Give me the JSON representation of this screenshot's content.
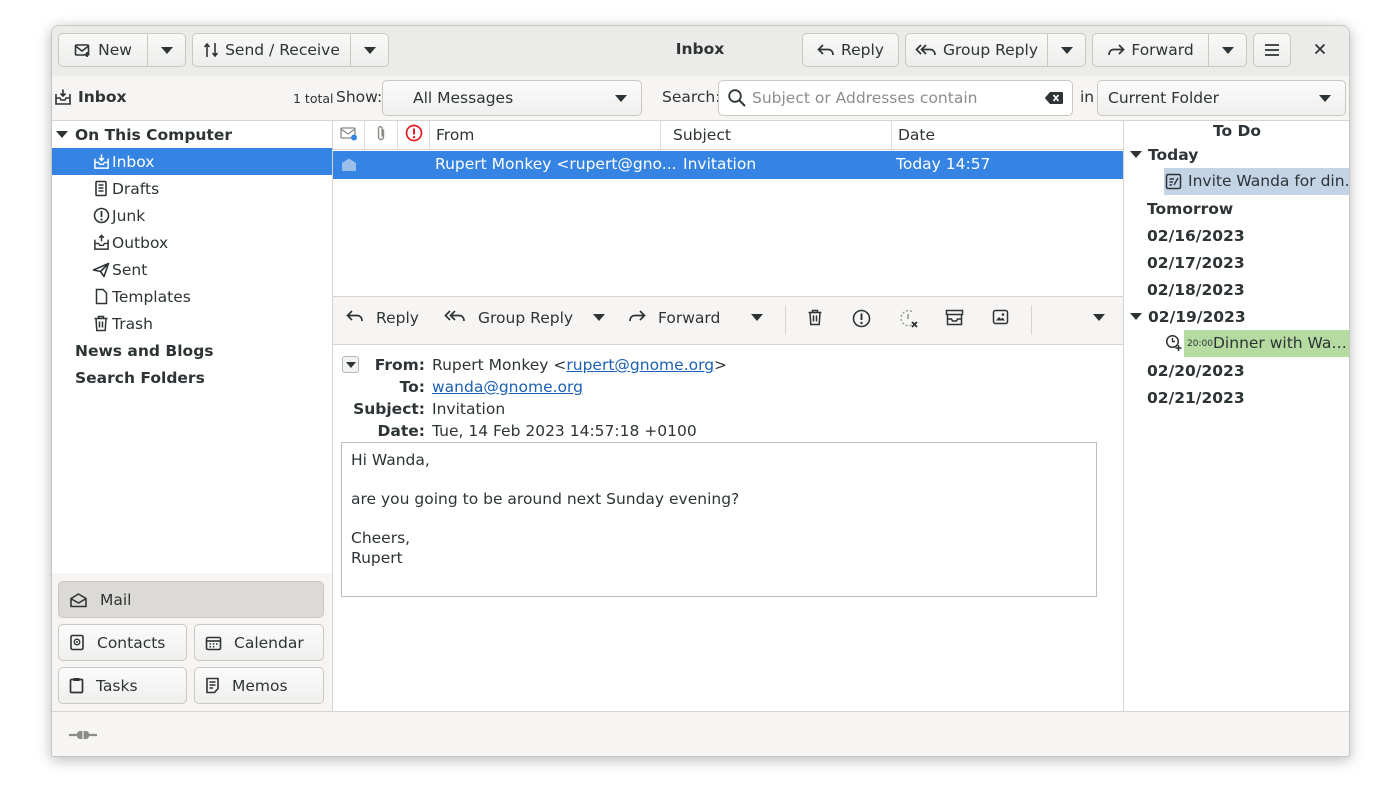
{
  "window": {
    "title": "Inbox"
  },
  "headerbar": {
    "new_label": "New",
    "send_receive_label": "Send / Receive",
    "reply_label": "Reply",
    "group_reply_label": "Group Reply",
    "forward_label": "Forward"
  },
  "filterbar": {
    "folder_name": "Inbox",
    "folder_count": "1 total",
    "show_label": "Show:",
    "show_value": "All Messages",
    "search_label": "Search:",
    "search_placeholder": "Subject or Addresses contain",
    "in_label": "in",
    "scope_value": "Current Folder"
  },
  "sidebar": {
    "account": "On This Computer",
    "folders": [
      {
        "label": "Inbox",
        "icon": "inbox-icon"
      },
      {
        "label": "Drafts",
        "icon": "drafts-icon"
      },
      {
        "label": "Junk",
        "icon": "junk-icon"
      },
      {
        "label": "Outbox",
        "icon": "outbox-icon"
      },
      {
        "label": "Sent",
        "icon": "sent-icon"
      },
      {
        "label": "Templates",
        "icon": "templates-icon"
      },
      {
        "label": "Trash",
        "icon": "trash-icon"
      }
    ],
    "news_and_blogs": "News and Blogs",
    "search_folders": "Search Folders"
  },
  "switcher": {
    "mail": "Mail",
    "contacts": "Contacts",
    "calendar": "Calendar",
    "tasks": "Tasks",
    "memos": "Memos"
  },
  "message_list": {
    "columns": {
      "from": "From",
      "subject": "Subject",
      "date": "Date"
    },
    "rows": [
      {
        "from": "Rupert Monkey <rupert@gno...",
        "subject": "Invitation",
        "date": "Today 14:57"
      }
    ]
  },
  "preview_toolbar": {
    "reply": "Reply",
    "group_reply": "Group Reply",
    "forward": "Forward"
  },
  "message": {
    "from_label": "From:",
    "from_name": "Rupert Monkey <",
    "from_email": "rupert@gnome.org",
    "from_suffix": ">",
    "to_label": "To:",
    "to_email": "wanda@gnome.org",
    "subject_label": "Subject:",
    "subject": "Invitation",
    "date_label": "Date:",
    "date": "Tue, 14 Feb 2023 14:57:18 +0100",
    "body": {
      "greeting": "Hi Wanda,",
      "line1": "are you going to be around next Sunday evening?",
      "closing": "Cheers,",
      "signature": "Rupert"
    }
  },
  "todo": {
    "title": "To Do",
    "today": "Today",
    "task1": "Invite Wanda for din…",
    "tomorrow": "Tomorrow",
    "d1": "02/16/2023",
    "d2": "02/17/2023",
    "d3": "02/18/2023",
    "d4": "02/19/2023",
    "event_time": "20:00",
    "event_title": "Dinner with Wa…",
    "d5": "02/20/2023",
    "d6": "02/21/2023"
  },
  "colors": {
    "selection": "#3584e4",
    "task_highlight": "#c3d4e6",
    "event_highlight": "#b5dba0",
    "important": "#e01b24",
    "link": "#1c60b3"
  }
}
